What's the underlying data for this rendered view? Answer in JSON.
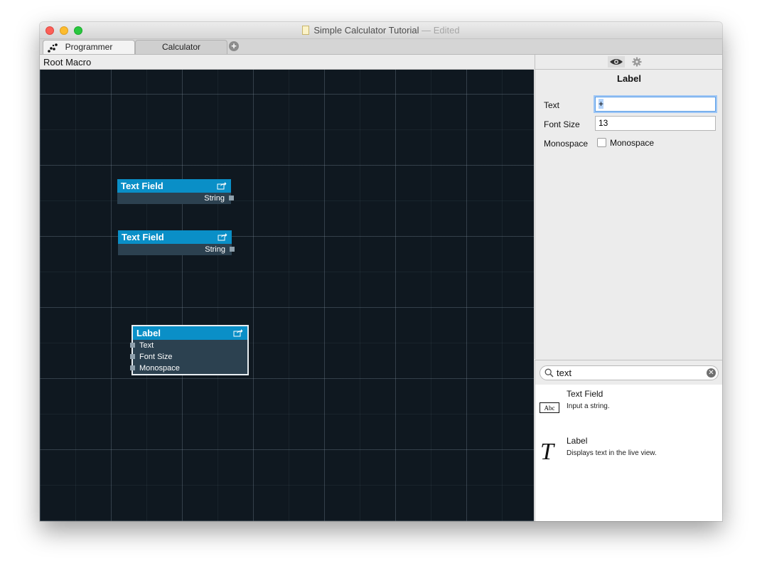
{
  "window": {
    "title": "Simple Calculator Tutorial",
    "separator": "—",
    "status": "Edited"
  },
  "tabs": [
    {
      "label": "Programmer",
      "active": true
    },
    {
      "label": "Calculator",
      "active": false
    }
  ],
  "breadcrumb": "Root Macro",
  "canvas": {
    "nodes": [
      {
        "title": "Text Field",
        "outputs": [
          "String"
        ]
      },
      {
        "title": "Text Field",
        "outputs": [
          "String"
        ]
      },
      {
        "title": "Label",
        "inputs": [
          "Text",
          "Font Size",
          "Monospace"
        ],
        "selected": true
      }
    ]
  },
  "inspector": {
    "heading": "Label",
    "text_label": "Text",
    "text_value": "+",
    "font_size_label": "Font Size",
    "font_size_value": "13",
    "monospace_label": "Monospace",
    "monospace_checkbox_label": "Monospace",
    "monospace_checked": false
  },
  "library": {
    "search_value": "text",
    "items": [
      {
        "title": "Text Field",
        "description": "Input a string.",
        "icon": "abc-text-field-icon",
        "icon_text": "Abc"
      },
      {
        "title": "Label",
        "description": "Displays text in the live view.",
        "icon": "text-t-icon",
        "icon_text": "T"
      }
    ]
  },
  "colors": {
    "node_header": "#0a8fc7",
    "node_body": "#2c4150",
    "canvas_bg": "#0f1820",
    "focus_ring": "#5da0e7"
  }
}
